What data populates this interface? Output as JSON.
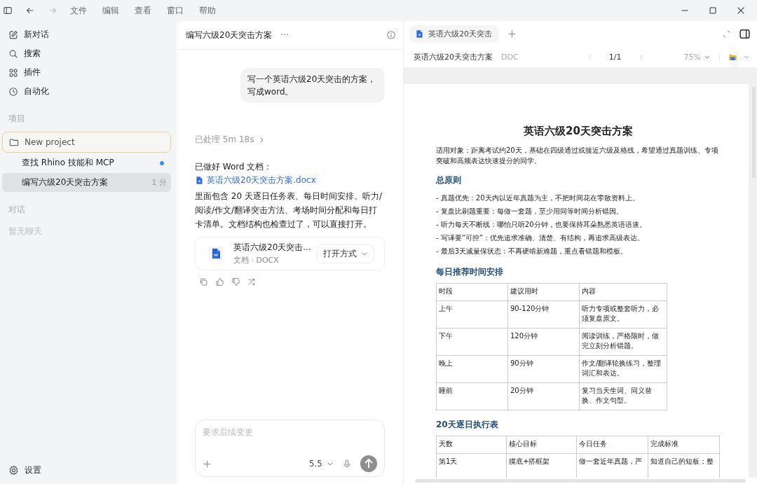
{
  "menu": [
    "文件",
    "编辑",
    "查看",
    "窗口",
    "帮助"
  ],
  "nav_history": [
    {
      "kind": "back",
      "disabled": false
    },
    {
      "kind": "forward",
      "disabled": true
    }
  ],
  "sidebar": {
    "items": [
      {
        "kind": "edit",
        "label": "新对话"
      },
      {
        "kind": "search",
        "label": "搜索"
      },
      {
        "kind": "plugins",
        "label": "插件"
      },
      {
        "kind": "clock",
        "label": "自动化"
      }
    ],
    "projects_heading": "项目",
    "projects": [
      {
        "label": "New project",
        "selected": true,
        "threads": [
          {
            "title": "查找 Rhino 技能和 MCP",
            "unread": true,
            "color": "#3b8ff0",
            "selected": false
          },
          {
            "title": "编写六级20天突击方案",
            "time": "1 分",
            "unread": false,
            "selected": true
          }
        ]
      }
    ],
    "chats_heading": "对话",
    "chats_empty": "暂无聊天",
    "settings": "设置"
  },
  "chat": {
    "title": "编写六级20天突击方案",
    "more": "···",
    "user_message": "写一个英语六级20天突击的方案，写成word。",
    "processed": "已处理 5m 18s",
    "reply_intro": "已做好 Word 文档：",
    "reply_link": "英语六级20天突击方案.docx",
    "reply_body": "里面包含 20 天逐日任务表、每日时间安排、听力/阅读/作文/翻译突击方法、考场时间分配和每日打卡清单。文档结构也检查过了，可以直接打开。",
    "file_card": {
      "name": "英语六级20天突击...",
      "meta": "文档 · DOCX",
      "action": "打开方式"
    },
    "composer": {
      "placeholder": "要求后续变更",
      "model": "5.5"
    }
  },
  "preview": {
    "tabs": [
      {
        "label": "英语六级20天突击",
        "selected": true
      }
    ],
    "doc_title": "英语六级20天突击方案",
    "doc_type": "DOC",
    "page": "1/1",
    "zoom": "75%",
    "document": {
      "title": "英语六级20天突击方案",
      "intro": "适用对象：距离考试约20天，基础在四级通过或接近六级及格线，希望通过真题训练、专项突破和高频表达快速提分的同学。",
      "sections": [
        {
          "heading": "总原则",
          "bullets": [
            "- 真题优先：20天内以近年真题为主，不把时间花在零散资料上。",
            "- 复盘比刷题重要：每做一套题，至少用同等时间分析错因。",
            "- 听力每天不断线：哪怕只听20分钟，也要保持耳朵熟悉英语语速。",
            "- 写译要“可控”：优先追求准确、清楚、有结构，再追求高级表达。",
            "- 最后3天减量保状态：不再硬啃新难题，重点看错题和模板。"
          ]
        },
        {
          "heading": "每日推荐时间安排",
          "table": {
            "columns": [
              "时段",
              "建议用时",
              "内容"
            ],
            "rows": [
              [
                "上午",
                "90-120分钟",
                "听力专项或整套听力，必须复盘原文。"
              ],
              [
                "下午",
                "120分钟",
                "阅读训练，严格限时，做完立刻分析错题。"
              ],
              [
                "晚上",
                "90分钟",
                "作文/翻译轮换练习，整理词汇和表达。"
              ],
              [
                "睡前",
                "20分钟",
                "复习当天生词、同义替换、作文句型。"
              ]
            ]
          }
        },
        {
          "heading": "20天逐日执行表",
          "table": {
            "columns": [
              "天数",
              "核心目标",
              "今日任务",
              "完成标准"
            ],
            "rows": [
              [
                "第1天",
                "摸底+搭框架",
                "做一套近年真题，严",
                "知道自己的短板；整"
              ]
            ]
          }
        }
      ]
    }
  }
}
